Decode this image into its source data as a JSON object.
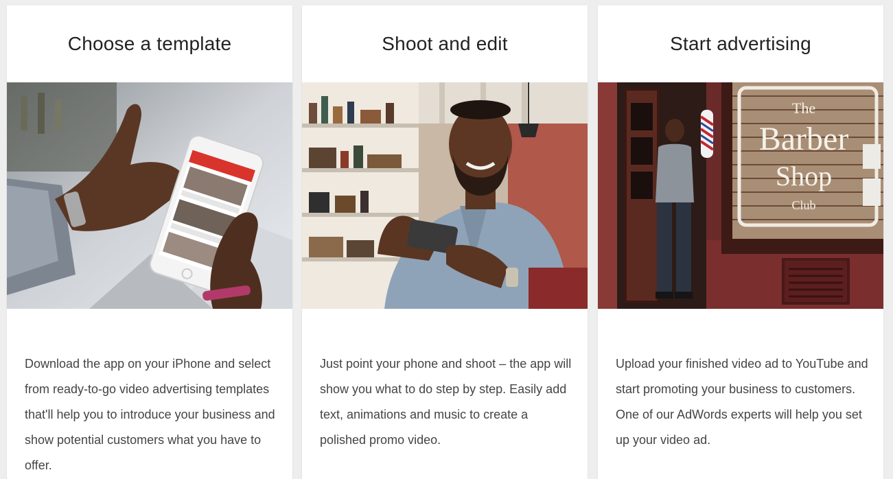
{
  "steps": [
    {
      "title": "Choose a template",
      "image_desc_icon": "hand-holding-phone-icon",
      "text": "Download the app on your iPhone and select from ready-to-go video advertising templates that'll help you to introduce your business and show potential customers what you have to offer."
    },
    {
      "title": "Shoot and edit",
      "image_desc_icon": "man-filming-with-phone-icon",
      "text": "Just point your phone and shoot – the app will show you what to do step by step. Easily add text, animations and music to create a polished promo video."
    },
    {
      "title": "Start advertising",
      "image_desc_icon": "storefront-icon",
      "text": "Upload your finished video ad to YouTube and start promoting your business to customers. One of our AdWords experts will help you set up your video ad."
    }
  ],
  "storefront_sign": {
    "line1": "The",
    "line2": "Barber",
    "line3": "Shop",
    "line4": "Club"
  },
  "colors": {
    "background": "#eeeeee",
    "card": "#ffffff",
    "title_text": "#222222",
    "body_text": "#444444",
    "phone_accent": "#d9342b"
  }
}
